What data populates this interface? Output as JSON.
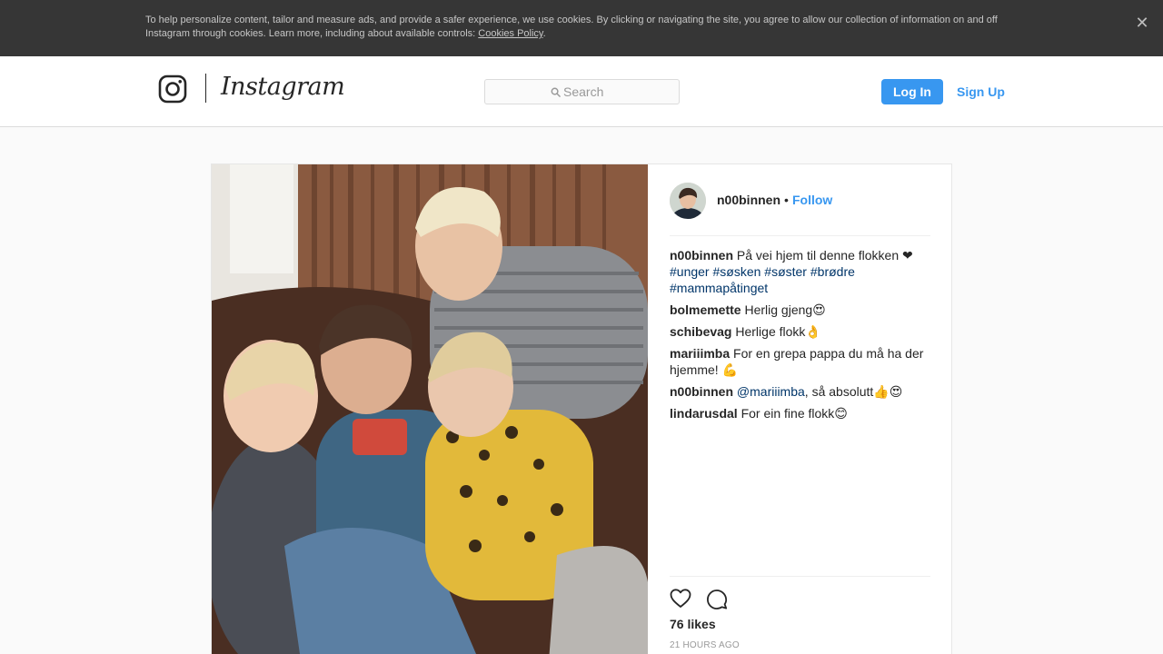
{
  "cookie_banner": {
    "text": "To help personalize content, tailor and measure ads, and provide a safer experience, we use cookies. By clicking or navigating the site, you agree to allow our collection of information on and off Instagram through cookies. Learn more, including about available controls: ",
    "link_label": "Cookies Policy",
    "period": ".",
    "close_icon": "close-icon",
    "close_glyph": "✕"
  },
  "nav": {
    "logo_text": "Instagram",
    "logo_icon": "instagram-glyph-icon",
    "search_placeholder": "Search",
    "login_label": "Log In",
    "signup_label": "Sign Up"
  },
  "post": {
    "username": "n00binnen",
    "dot": "•",
    "follow_label": "Follow",
    "caption": {
      "user": "n00binnen",
      "text": " På vei hjem til denne flokken ❤ ",
      "tags": [
        "#unger",
        "#søsken",
        "#søster",
        "#brødre",
        "#mammapåtinget"
      ]
    },
    "comments": [
      {
        "user": "bolmemette",
        "text": " Herlig gjeng😍"
      },
      {
        "user": "schibevag",
        "text": " Herlige flokk👌"
      },
      {
        "user": "mariiimba",
        "text": " For en grepa pappa du må ha der hjemme! 💪"
      },
      {
        "user": "n00binnen",
        "mention": "@mariiimba",
        "text": ", så absolutt👍😍"
      },
      {
        "user": "lindarusdal",
        "text": " For ein fine flokk😊"
      }
    ],
    "likes": "76 likes",
    "time": "21 HOURS AGO"
  },
  "colors": {
    "accent": "#3897f0",
    "hashtag": "#003569",
    "banner_bg": "#363636"
  }
}
